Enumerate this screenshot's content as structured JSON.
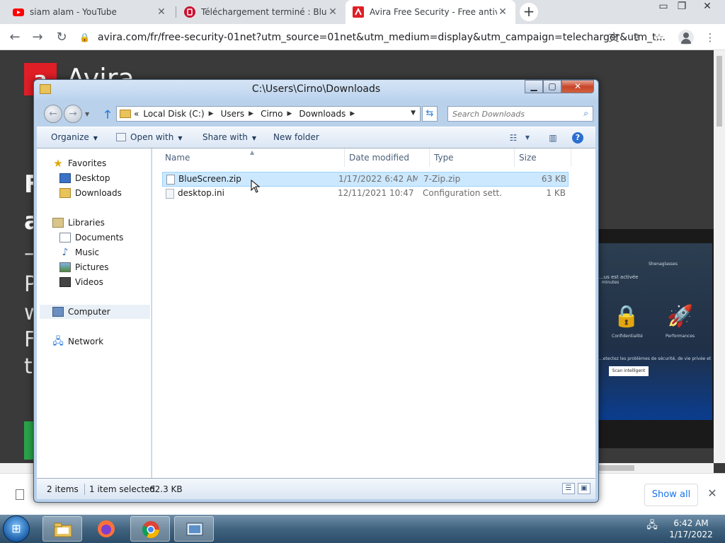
{
  "browser": {
    "tabs": [
      {
        "title": "siam alam - YouTube",
        "favicon": "youtube-icon"
      },
      {
        "title": "Téléchargement terminé : BlueScreen",
        "favicon": "01net-icon"
      },
      {
        "title": "Avira Free Security - Free antivirus",
        "favicon": "avira-icon",
        "active": true
      }
    ],
    "new_tab": "+",
    "url": "avira.com/fr/free-security-01net?utm_source=01net&utm_medium=display&utm_campaign=telecharger&utm_t...",
    "download_bar": {
      "show_all": "Show all"
    }
  },
  "page": {
    "brand": "Avira",
    "headline_chars": [
      "F",
      "a",
      "—"
    ],
    "body_chars": [
      "P",
      "w",
      "F",
      "t"
    ],
    "laptop": {
      "account": "Shenaglasses",
      "status": "...us est activée",
      "status_sub": "minutes",
      "privacy": "Confidentialité",
      "performance": "Performances",
      "scan_desc": "...etectez les problèmes de sécurité, de vie privée et performances.",
      "scan_button": "Scan intelligent"
    }
  },
  "explorer": {
    "title": "C:\\Users\\Cirno\\Downloads",
    "address": {
      "overflow": "«",
      "segments": [
        "Local Disk (C:)",
        "Users",
        "Cirno",
        "Downloads"
      ]
    },
    "search_placeholder": "Search Downloads",
    "commands": {
      "organize": "Organize",
      "open_with": "Open with",
      "share_with": "Share with",
      "new_folder": "New folder"
    },
    "nav": {
      "favorites": "Favorites",
      "desktop": "Desktop",
      "downloads": "Downloads",
      "libraries": "Libraries",
      "documents": "Documents",
      "music": "Music",
      "pictures": "Pictures",
      "videos": "Videos",
      "computer": "Computer",
      "network": "Network"
    },
    "columns": {
      "name": "Name",
      "date": "Date modified",
      "type": "Type",
      "size": "Size"
    },
    "files": [
      {
        "name": "BlueScreen.zip",
        "date": "1/17/2022 6:42 AM",
        "type": "7-Zip.zip",
        "size": "63 KB",
        "selected": true
      },
      {
        "name": "desktop.ini",
        "date": "12/11/2021 10:47 ...",
        "type": "Configuration sett...",
        "size": "1 KB",
        "selected": false
      }
    ],
    "status": {
      "count": "2 items",
      "selected": "1 item selected",
      "size": "62.3 KB"
    }
  },
  "taskbar": {
    "time": "6:42 AM",
    "date": "1/17/2022"
  }
}
